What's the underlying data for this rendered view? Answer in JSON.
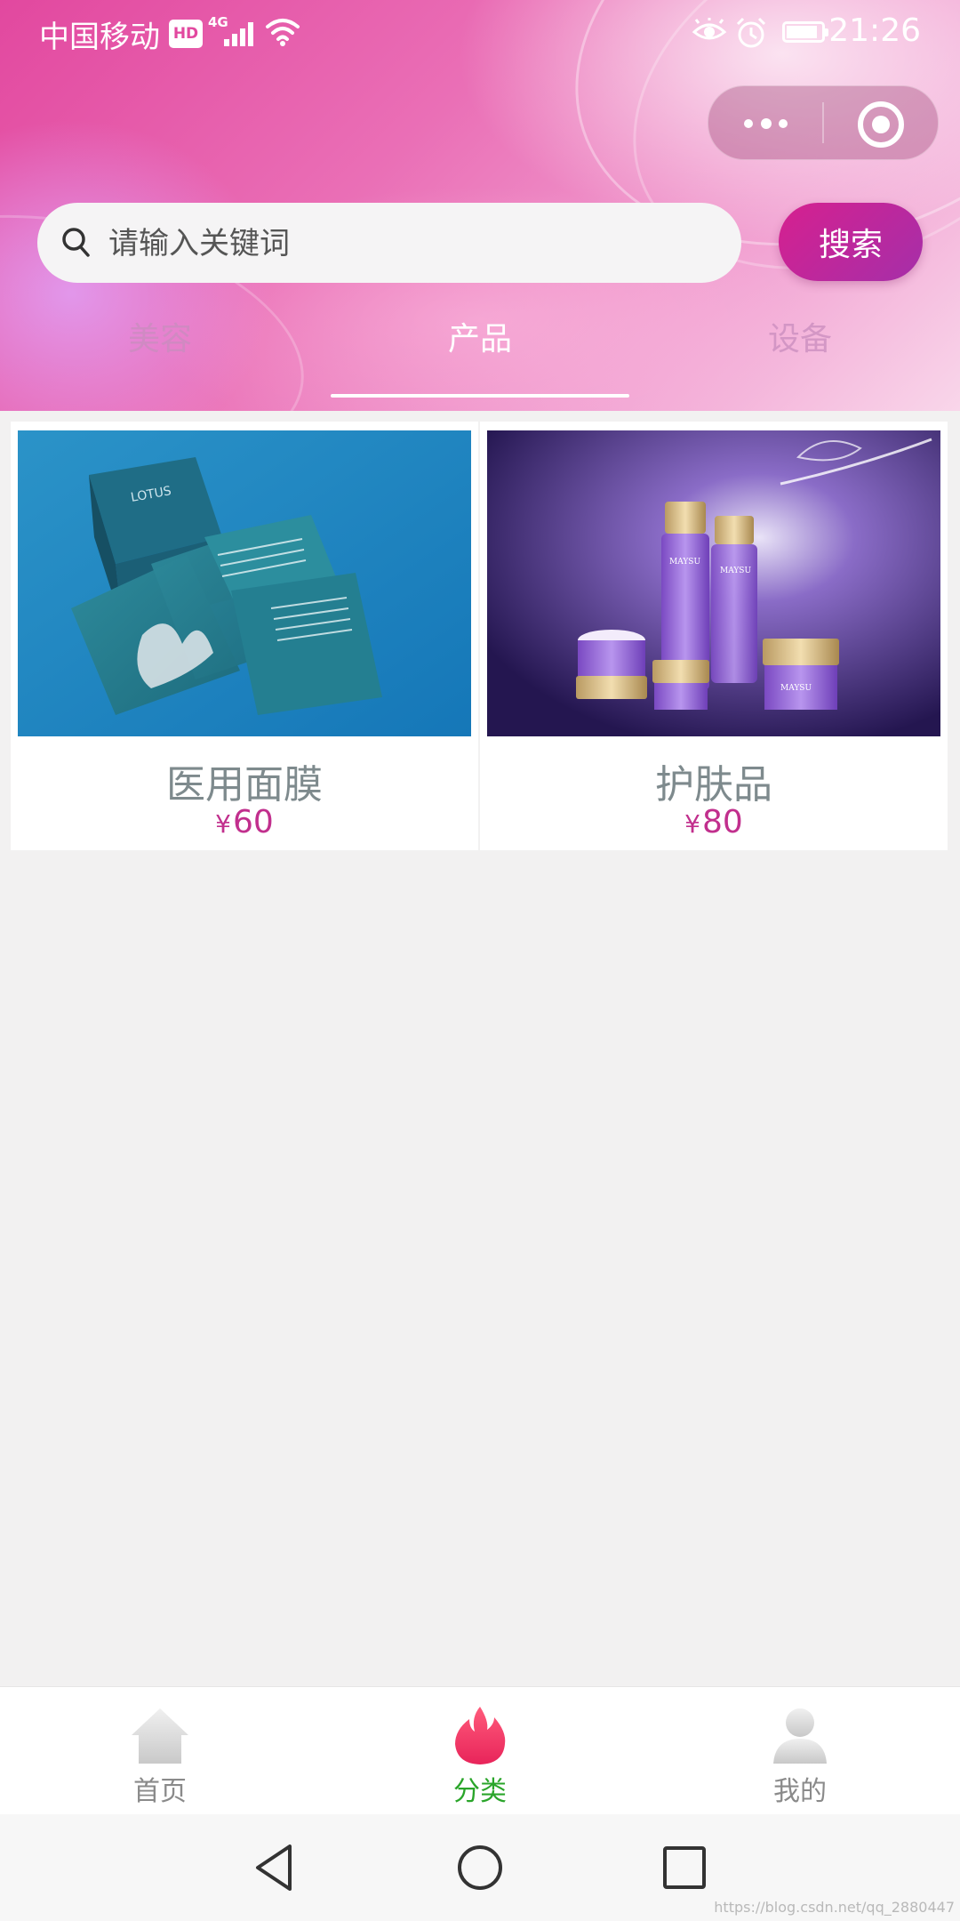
{
  "status_bar": {
    "carrier": "中国移动",
    "hd": "HD",
    "network": "4G",
    "time": "21:26"
  },
  "search": {
    "placeholder": "请输入关键词",
    "button_label": "搜索"
  },
  "tabs": [
    {
      "label": "美容",
      "active": false
    },
    {
      "label": "产品",
      "active": true
    },
    {
      "label": "设备",
      "active": false
    }
  ],
  "products": [
    {
      "name": "医用面膜",
      "currency": "¥",
      "price": "60",
      "image": "medical-face-mask-pack"
    },
    {
      "name": "护肤品",
      "currency": "¥",
      "price": "80",
      "image": "skincare-set"
    }
  ],
  "tabbar": {
    "items": [
      {
        "label": "首页",
        "icon": "home-icon",
        "active": false
      },
      {
        "label": "分类",
        "icon": "flame-icon",
        "active": true
      },
      {
        "label": "我的",
        "icon": "user-icon",
        "active": false
      }
    ]
  },
  "colors": {
    "accent": "#c12f8d",
    "tab_active": "#2aa52a",
    "tab_inactive": "#8a8a8a"
  },
  "watermark": "https://blog.csdn.net/qq_2880447"
}
